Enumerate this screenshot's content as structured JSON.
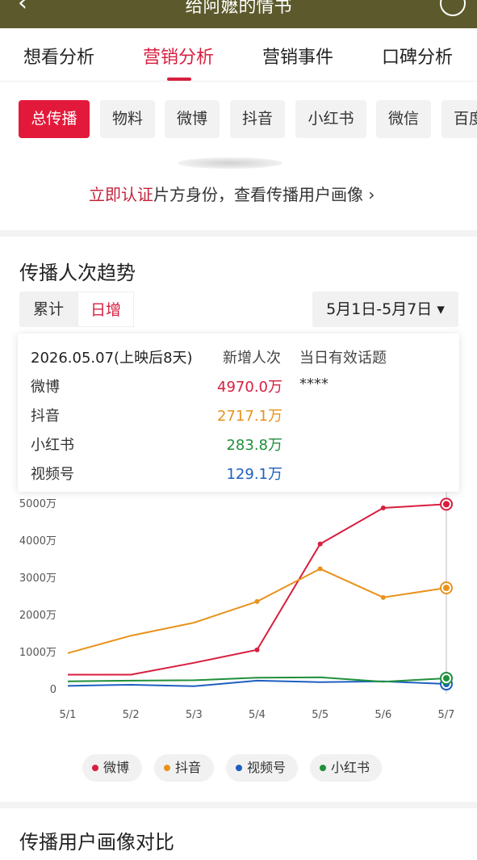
{
  "header": {
    "title": "给阿嬷的情书"
  },
  "tabs": [
    "想看分析",
    "营销分析",
    "营销事件",
    "口碑分析"
  ],
  "active_tab": 1,
  "channels": [
    "总传播",
    "物料",
    "微博",
    "抖音",
    "小红书",
    "微信",
    "百度"
  ],
  "auth": {
    "link": "立即认证",
    "text": "片方身份，查看传播用户画像",
    "arrow": "›"
  },
  "trend": {
    "title": "传播人次趋势",
    "toggle": [
      "累计",
      "日增"
    ],
    "active_toggle": 1,
    "date_range": "5月1日-5月7日",
    "date_range_arrow": "▾"
  },
  "tooltip": {
    "date": "2026.05.07(上映后8天)",
    "col_new": "新增人次",
    "col_topic": "当日有效话题",
    "topic": "****",
    "rows": [
      {
        "name": "微博",
        "value": "4970.0万",
        "color": "#d81e3f"
      },
      {
        "name": "抖音",
        "value": "2717.1万",
        "color": "#e8931d"
      },
      {
        "name": "小红书",
        "value": "283.8万",
        "color": "#1f8f3b"
      },
      {
        "name": "视频号",
        "value": "129.1万",
        "color": "#1d5fc1"
      }
    ]
  },
  "chart_data": {
    "type": "line",
    "x": [
      "5/1",
      "5/2",
      "5/3",
      "5/4",
      "5/5",
      "5/6",
      "5/7"
    ],
    "y_ticks": [
      "0",
      "1000万",
      "2000万",
      "3000万",
      "4000万",
      "5000万"
    ],
    "ylim": [
      0,
      5000
    ],
    "series": [
      {
        "name": "微博",
        "color": "#d81e3f",
        "values": [
          380,
          380,
          700,
          1050,
          3900,
          4870,
          4970
        ]
      },
      {
        "name": "抖音",
        "color": "#e8931d",
        "values": [
          960,
          1430,
          1780,
          2350,
          3230,
          2460,
          2717.1
        ]
      },
      {
        "name": "视频号",
        "color": "#1d5fc1",
        "values": [
          80,
          110,
          70,
          220,
          180,
          200,
          129.1
        ]
      },
      {
        "name": "小红书",
        "color": "#1f8f3b",
        "values": [
          200,
          220,
          230,
          300,
          310,
          190,
          283.8
        ]
      }
    ]
  },
  "legend": [
    {
      "name": "微博",
      "color": "#d81e3f"
    },
    {
      "name": "抖音",
      "color": "#e8931d"
    },
    {
      "name": "视频号",
      "color": "#1d5fc1"
    },
    {
      "name": "小红书",
      "color": "#1f8f3b"
    }
  ],
  "portrait": {
    "title": "传播用户画像对比"
  }
}
